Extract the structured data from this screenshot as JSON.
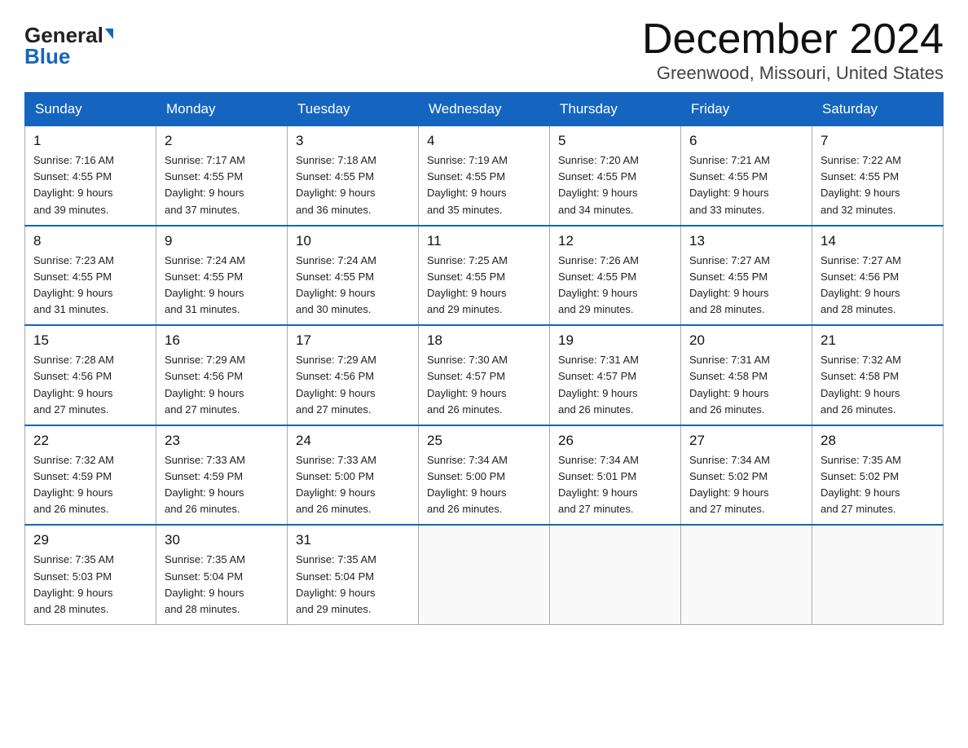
{
  "header": {
    "logo_general": "General",
    "logo_blue": "Blue",
    "month_title": "December 2024",
    "location": "Greenwood, Missouri, United States"
  },
  "columns": [
    "Sunday",
    "Monday",
    "Tuesday",
    "Wednesday",
    "Thursday",
    "Friday",
    "Saturday"
  ],
  "weeks": [
    [
      {
        "day": "1",
        "sunrise": "7:16 AM",
        "sunset": "4:55 PM",
        "daylight": "9 hours and 39 minutes."
      },
      {
        "day": "2",
        "sunrise": "7:17 AM",
        "sunset": "4:55 PM",
        "daylight": "9 hours and 37 minutes."
      },
      {
        "day": "3",
        "sunrise": "7:18 AM",
        "sunset": "4:55 PM",
        "daylight": "9 hours and 36 minutes."
      },
      {
        "day": "4",
        "sunrise": "7:19 AM",
        "sunset": "4:55 PM",
        "daylight": "9 hours and 35 minutes."
      },
      {
        "day": "5",
        "sunrise": "7:20 AM",
        "sunset": "4:55 PM",
        "daylight": "9 hours and 34 minutes."
      },
      {
        "day": "6",
        "sunrise": "7:21 AM",
        "sunset": "4:55 PM",
        "daylight": "9 hours and 33 minutes."
      },
      {
        "day": "7",
        "sunrise": "7:22 AM",
        "sunset": "4:55 PM",
        "daylight": "9 hours and 32 minutes."
      }
    ],
    [
      {
        "day": "8",
        "sunrise": "7:23 AM",
        "sunset": "4:55 PM",
        "daylight": "9 hours and 31 minutes."
      },
      {
        "day": "9",
        "sunrise": "7:24 AM",
        "sunset": "4:55 PM",
        "daylight": "9 hours and 31 minutes."
      },
      {
        "day": "10",
        "sunrise": "7:24 AM",
        "sunset": "4:55 PM",
        "daylight": "9 hours and 30 minutes."
      },
      {
        "day": "11",
        "sunrise": "7:25 AM",
        "sunset": "4:55 PM",
        "daylight": "9 hours and 29 minutes."
      },
      {
        "day": "12",
        "sunrise": "7:26 AM",
        "sunset": "4:55 PM",
        "daylight": "9 hours and 29 minutes."
      },
      {
        "day": "13",
        "sunrise": "7:27 AM",
        "sunset": "4:55 PM",
        "daylight": "9 hours and 28 minutes."
      },
      {
        "day": "14",
        "sunrise": "7:27 AM",
        "sunset": "4:56 PM",
        "daylight": "9 hours and 28 minutes."
      }
    ],
    [
      {
        "day": "15",
        "sunrise": "7:28 AM",
        "sunset": "4:56 PM",
        "daylight": "9 hours and 27 minutes."
      },
      {
        "day": "16",
        "sunrise": "7:29 AM",
        "sunset": "4:56 PM",
        "daylight": "9 hours and 27 minutes."
      },
      {
        "day": "17",
        "sunrise": "7:29 AM",
        "sunset": "4:56 PM",
        "daylight": "9 hours and 27 minutes."
      },
      {
        "day": "18",
        "sunrise": "7:30 AM",
        "sunset": "4:57 PM",
        "daylight": "9 hours and 26 minutes."
      },
      {
        "day": "19",
        "sunrise": "7:31 AM",
        "sunset": "4:57 PM",
        "daylight": "9 hours and 26 minutes."
      },
      {
        "day": "20",
        "sunrise": "7:31 AM",
        "sunset": "4:58 PM",
        "daylight": "9 hours and 26 minutes."
      },
      {
        "day": "21",
        "sunrise": "7:32 AM",
        "sunset": "4:58 PM",
        "daylight": "9 hours and 26 minutes."
      }
    ],
    [
      {
        "day": "22",
        "sunrise": "7:32 AM",
        "sunset": "4:59 PM",
        "daylight": "9 hours and 26 minutes."
      },
      {
        "day": "23",
        "sunrise": "7:33 AM",
        "sunset": "4:59 PM",
        "daylight": "9 hours and 26 minutes."
      },
      {
        "day": "24",
        "sunrise": "7:33 AM",
        "sunset": "5:00 PM",
        "daylight": "9 hours and 26 minutes."
      },
      {
        "day": "25",
        "sunrise": "7:34 AM",
        "sunset": "5:00 PM",
        "daylight": "9 hours and 26 minutes."
      },
      {
        "day": "26",
        "sunrise": "7:34 AM",
        "sunset": "5:01 PM",
        "daylight": "9 hours and 27 minutes."
      },
      {
        "day": "27",
        "sunrise": "7:34 AM",
        "sunset": "5:02 PM",
        "daylight": "9 hours and 27 minutes."
      },
      {
        "day": "28",
        "sunrise": "7:35 AM",
        "sunset": "5:02 PM",
        "daylight": "9 hours and 27 minutes."
      }
    ],
    [
      {
        "day": "29",
        "sunrise": "7:35 AM",
        "sunset": "5:03 PM",
        "daylight": "9 hours and 28 minutes."
      },
      {
        "day": "30",
        "sunrise": "7:35 AM",
        "sunset": "5:04 PM",
        "daylight": "9 hours and 28 minutes."
      },
      {
        "day": "31",
        "sunrise": "7:35 AM",
        "sunset": "5:04 PM",
        "daylight": "9 hours and 29 minutes."
      },
      null,
      null,
      null,
      null
    ]
  ],
  "labels": {
    "sunrise_prefix": "Sunrise: ",
    "sunset_prefix": "Sunset: ",
    "daylight_prefix": "Daylight: "
  }
}
